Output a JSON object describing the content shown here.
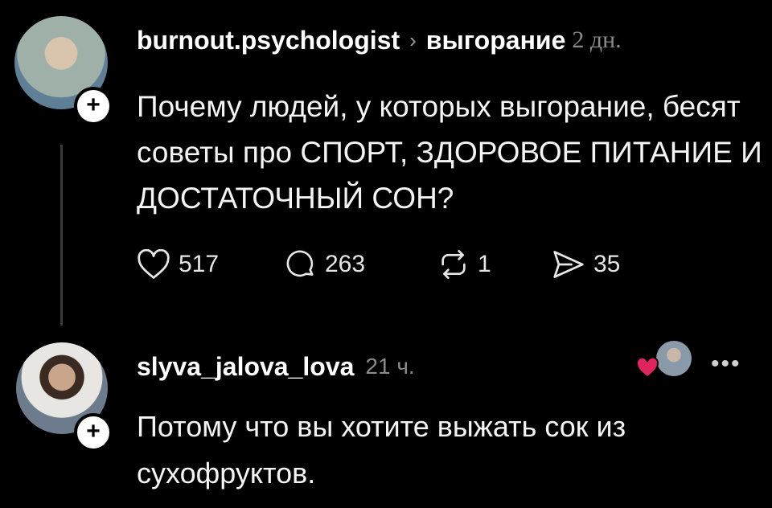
{
  "post": {
    "username": "burnout.psychologist",
    "separator": "›",
    "topic": "выгорание",
    "time": "2 дн.",
    "text": "Почему людей, у которых выгорание, бесят советы про СПОРТ, ЗДОРОВОЕ ПИТАНИЕ И ДОСТАТОЧНЫЙ СОН?",
    "likes": "517",
    "comments": "263",
    "reposts": "1",
    "shares": "35"
  },
  "reply": {
    "username": "slyva_jalova_lova",
    "time": "21 ч.",
    "text": "Потому что вы хотите выжать сок из сухофруктов.",
    "more": "•••"
  },
  "icons": {
    "follow": "+",
    "like": "heart-outline-icon",
    "comment": "comment-bubble-icon",
    "repost": "repost-icon",
    "share": "send-icon",
    "liked_by": "red-heart-icon"
  },
  "colors": {
    "background": "#000000",
    "text": "#f2f2f2",
    "muted": "#8a8a8a",
    "heart": "#e0245e"
  }
}
